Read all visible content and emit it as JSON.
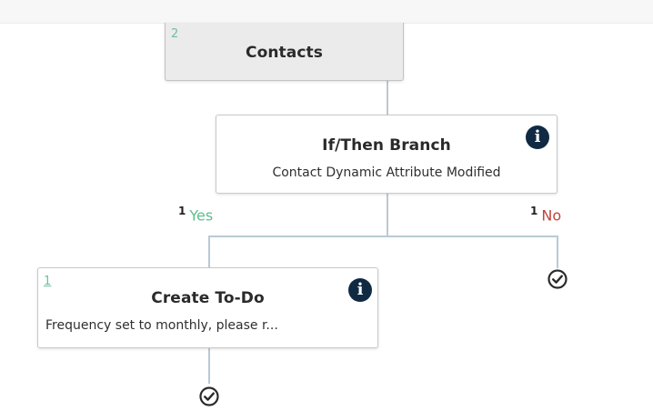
{
  "trigger_node": {
    "count": "2",
    "title": "Contacts"
  },
  "branch_node": {
    "title": "If/Then Branch",
    "description": "Contact Dynamic Attribute Modified",
    "info_icon": "i"
  },
  "yes_label": {
    "count": "1",
    "text": "Yes"
  },
  "no_label": {
    "count": "1",
    "text": "No"
  },
  "todo_node": {
    "count": "1",
    "title": "Create To-Do",
    "description": "Frequency set to monthly, please r...",
    "info_icon": "i"
  },
  "colors": {
    "yes": "#5cc08c",
    "no": "#c0443d",
    "info_icon_bg": "#102a43",
    "connector": "#b9cad6",
    "count": "#6fbf9a"
  }
}
